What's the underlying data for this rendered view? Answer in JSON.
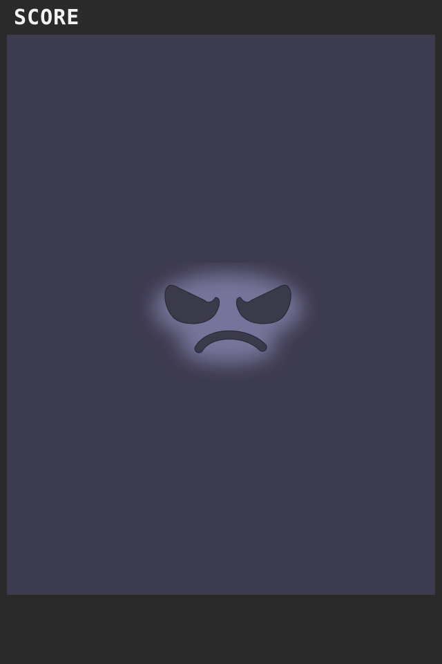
{
  "hud": {
    "score_label": "SCORE"
  },
  "game": {
    "character": {
      "expression": "angry",
      "face_icon": "angry-face-icon"
    }
  },
  "colors": {
    "background": "#2a2a2a",
    "play_area": "#3d3b4e",
    "score_text": "#f2f2f2",
    "face_glow": "#8a88b4",
    "face_features": "#3b3a4a"
  }
}
